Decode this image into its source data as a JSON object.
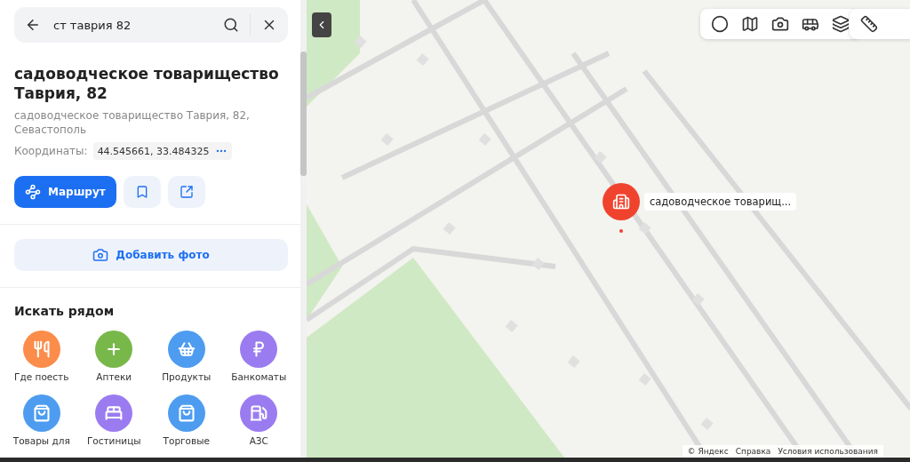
{
  "search": {
    "value": "ст таврия 82"
  },
  "place": {
    "title": "садоводческое товарищество Таврия, 82",
    "address": "садоводческое товарищество Таврия, 82, Севастополь",
    "coords_label": "Координаты:",
    "coords": "44.545661, 33.484325"
  },
  "actions": {
    "route": "Маршрут",
    "add_photo": "Добавить фото"
  },
  "nearby": {
    "title": "Искать рядом",
    "items": [
      {
        "label": "Где поесть",
        "kind": "food",
        "color": "#fb8c4a"
      },
      {
        "label": "Аптеки",
        "kind": "pharmacy",
        "color": "#78b84a"
      },
      {
        "label": "Продукты",
        "kind": "grocery",
        "color": "#4d9cf0"
      },
      {
        "label": "Банкоматы",
        "kind": "atm",
        "color": "#9a7cf0"
      },
      {
        "label": "Товары для",
        "kind": "bag",
        "color": "#4d9cf0"
      },
      {
        "label": "Гостиницы",
        "kind": "hotel",
        "color": "#9a7cf0"
      },
      {
        "label": "Торговые",
        "kind": "bag",
        "color": "#4d9cf0"
      },
      {
        "label": "АЗС",
        "kind": "fuel",
        "color": "#9a7cf0"
      }
    ]
  },
  "map": {
    "pin_label": "садоводческое товарищ...",
    "attribution": [
      "© Яндекс",
      "Справка",
      "Условия использования"
    ]
  }
}
